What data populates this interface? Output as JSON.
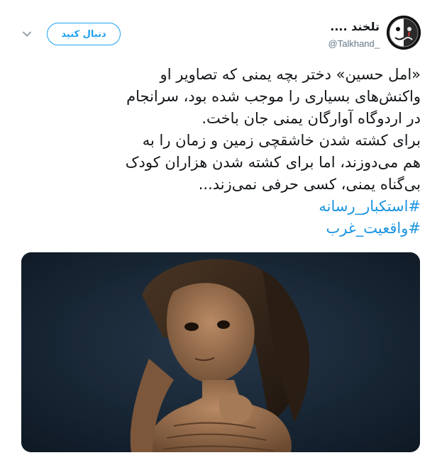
{
  "user": {
    "display_name": "تلخند ....",
    "handle": "@Talkhand_"
  },
  "follow_button": {
    "label": "دنبال کنید"
  },
  "tweet": {
    "lines": [
      "«امل حسین» دختر بچه یمنی که تصاویر او",
      "واکنش‌های بسیاری را موجب شده بود، سرانجام",
      "در اردوگاه آوارگان یمنی جان باخت.",
      "برای کشته شدن خاشقچی زمین و زمان را به",
      "هم می‌دوزند، اما برای کشته شدن هزاران کودک",
      "بی‌گناه یمنی، کسی حرفی نمی‌زند..."
    ],
    "hashtags": [
      "#استکبار_رسانه",
      "#واقعیت_غرب"
    ]
  },
  "icons": {
    "avatar": "sad-laughing-face-icon",
    "menu": "chevron-down-icon"
  },
  "colors": {
    "accent": "#1da1f2",
    "hashtag": "#1b95e0",
    "text": "#14171a",
    "muted": "#657786"
  }
}
